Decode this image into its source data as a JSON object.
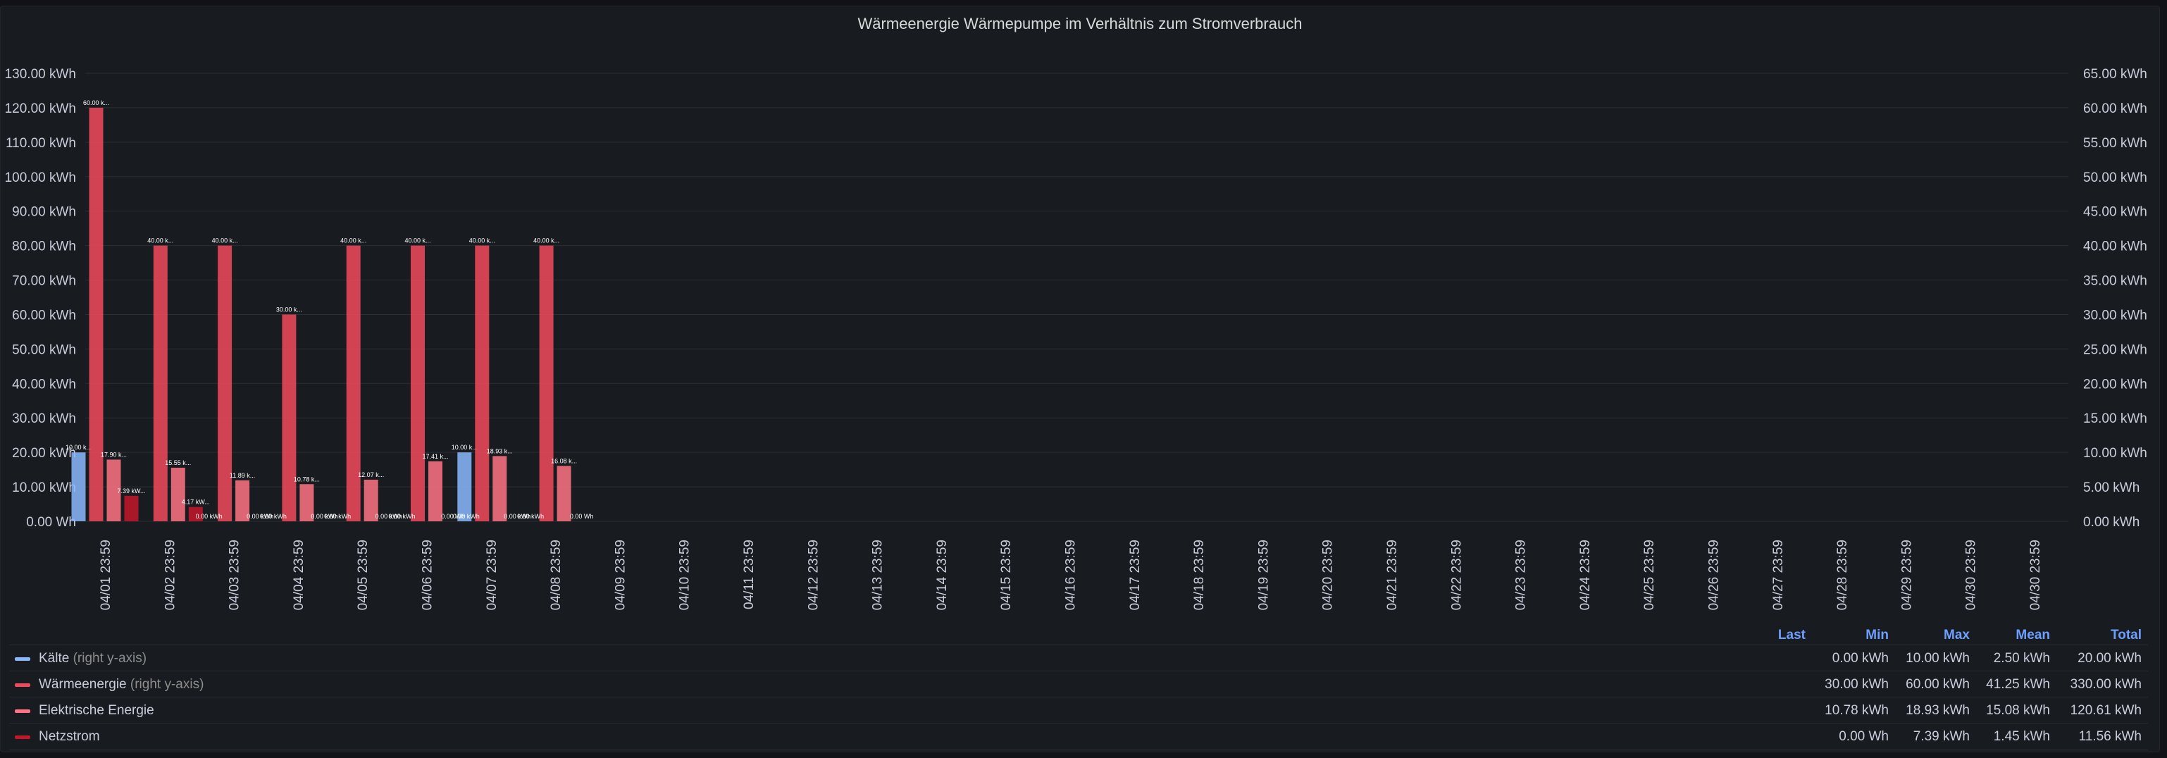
{
  "chart_data": {
    "type": "bar",
    "title": "Wärmeenergie Wärmepumpe im Verhältnis zum Stromverbrauch",
    "categories": [
      "04/01 23:59",
      "04/02 23:59",
      "04/03 23:59",
      "04/04 23:59",
      "04/05 23:59",
      "04/06 23:59",
      "04/07 23:59",
      "04/08 23:59",
      "04/09 23:59",
      "04/10 23:59",
      "04/11 23:59",
      "04/12 23:59",
      "04/13 23:59",
      "04/14 23:59",
      "04/15 23:59",
      "04/16 23:59",
      "04/17 23:59",
      "04/18 23:59",
      "04/19 23:59",
      "04/20 23:59",
      "04/21 23:59",
      "04/22 23:59",
      "04/23 23:59",
      "04/24 23:59",
      "04/25 23:59",
      "04/26 23:59",
      "04/27 23:59",
      "04/28 23:59",
      "04/29 23:59",
      "04/30 23:59",
      "04/30 23:59"
    ],
    "left_axis": {
      "ylim": [
        0,
        130
      ],
      "ticks": [
        "0.00 Wh",
        "10.00 kWh",
        "20.00 kWh",
        "30.00 kWh",
        "40.00 kWh",
        "50.00 kWh",
        "60.00 kWh",
        "70.00 kWh",
        "80.00 kWh",
        "90.00 kWh",
        "100.00 kWh",
        "110.00 kWh",
        "120.00 kWh",
        "130.00 kWh"
      ]
    },
    "right_axis": {
      "ylim": [
        0,
        65
      ],
      "ticks": [
        "0.00 kWh",
        "5.00 kWh",
        "10.00 kWh",
        "15.00 kWh",
        "20.00 kWh",
        "25.00 kWh",
        "30.00 kWh",
        "35.00 kWh",
        "40.00 kWh",
        "45.00 kWh",
        "50.00 kWh",
        "55.00 kWh",
        "60.00 kWh",
        "65.00 kWh"
      ]
    },
    "grid": true,
    "legend": "bottom",
    "series": [
      {
        "name": "Kälte",
        "axis": "right",
        "color": "#8ab8ff",
        "values": [
          10,
          null,
          null,
          null,
          null,
          null,
          10,
          null
        ],
        "labels": [
          "10.00 k...",
          "",
          "",
          "",
          "",
          "",
          "10.00 k...",
          ""
        ]
      },
      {
        "name": "Wärmeenergie",
        "axis": "right",
        "color": "#f2495c",
        "values": [
          60,
          40,
          40,
          30,
          40,
          40,
          40,
          40
        ],
        "labels": [
          "60.00 k...",
          "40.00 k...",
          "40.00 k...",
          "30.00 k...",
          "40.00 k...",
          "40.00 k...",
          "40.00 k...",
          "40.00 k..."
        ]
      },
      {
        "name": "Elektrische Energie",
        "axis": "left",
        "color": "#ff7383",
        "values": [
          17.9,
          15.55,
          11.89,
          10.78,
          12.07,
          17.41,
          18.93,
          16.08
        ],
        "labels": [
          "17.90 k...",
          "15.55 k...",
          "11.89 k...",
          "10.78 k...",
          "12.07 k...",
          "17.41 k...",
          "18.93 k...",
          "16.08 k..."
        ]
      },
      {
        "name": "Netzstrom",
        "axis": "left",
        "color": "#c4162a",
        "values": [
          7.39,
          4.17,
          0,
          0,
          0,
          0,
          0,
          0
        ],
        "labels": [
          "7.39 kW...",
          "4.17 kW...",
          "0.00 kWh",
          "0.00 kWh",
          "0.00 kWh",
          "0.00 Wh",
          "0.00 kWh",
          "0.00 Wh"
        ]
      }
    ],
    "extra_labels": [
      "0.00 kWh",
      "0.00 kWh",
      "0.00 kWh",
      "0.00 kWh",
      "0.00 kWh",
      "0.00 kWh"
    ]
  },
  "legend": {
    "right_axis_note": "(right y-axis)",
    "columns": [
      "Last",
      "Min",
      "Max",
      "Mean",
      "Total"
    ],
    "rows": [
      {
        "name": "Kälte",
        "right_axis": true,
        "color": "#8ab8ff",
        "last": "",
        "min": "0.00 kWh",
        "max": "10.00 kWh",
        "mean": "2.50 kWh",
        "total": "20.00 kWh"
      },
      {
        "name": "Wärmeenergie",
        "right_axis": true,
        "color": "#f2495c",
        "last": "",
        "min": "30.00 kWh",
        "max": "60.00 kWh",
        "mean": "41.25 kWh",
        "total": "330.00 kWh"
      },
      {
        "name": "Elektrische Energie",
        "right_axis": false,
        "color": "#ff7383",
        "last": "",
        "min": "10.78 kWh",
        "max": "18.93 kWh",
        "mean": "15.08 kWh",
        "total": "120.61 kWh"
      },
      {
        "name": "Netzstrom",
        "right_axis": false,
        "color": "#c4162a",
        "last": "",
        "min": "0.00 Wh",
        "max": "7.39 kWh",
        "mean": "1.45 kWh",
        "total": "11.56 kWh"
      }
    ]
  }
}
